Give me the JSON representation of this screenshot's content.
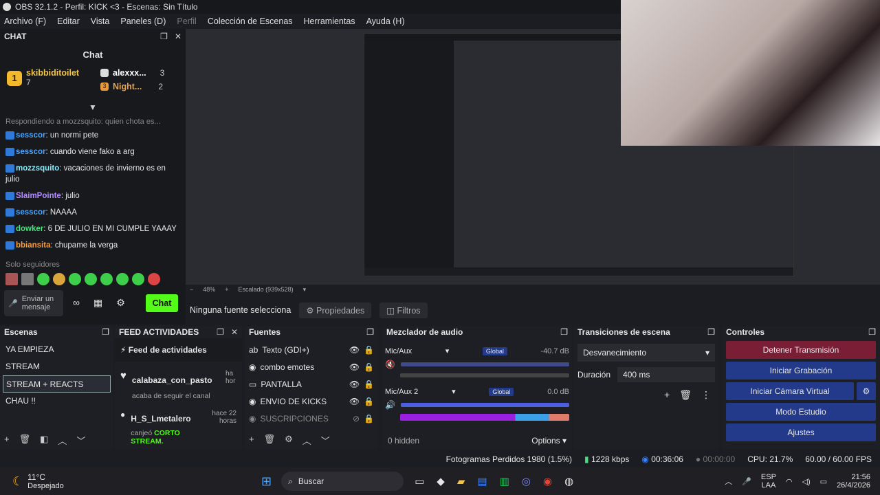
{
  "window": {
    "title": "OBS 32.1.2 - Perfil: KICK <3 - Escenas: Sin Título"
  },
  "menu": [
    "Archivo (F)",
    "Editar",
    "Vista",
    "Paneles (D)",
    "Perfil",
    "Colección de Escenas",
    "Herramientas",
    "Ayuda (H)"
  ],
  "chat": {
    "dock_title": "CHAT",
    "title": "Chat",
    "leaders": [
      {
        "rank": "1",
        "name": "skibbiditoilet",
        "count": "7"
      },
      {
        "rank": "",
        "name": "alexxx...",
        "count": "3"
      },
      {
        "rank": "3",
        "name": "Night...",
        "count": "2"
      }
    ],
    "reply": "Respondiendo a mozzsquito: quien chota es...",
    "messages": [
      {
        "user": "sesscor",
        "color": "#4fa3f7",
        "text": "un normi pete"
      },
      {
        "user": "sesscor",
        "color": "#4fa3f7",
        "text": "cuando viene fako a arg"
      },
      {
        "user": "mozzsquito",
        "color": "#8be9fd",
        "text": "vacaciones de invierno es en julio"
      },
      {
        "user": "SlaimPointe",
        "color": "#b48cff",
        "text": "julio"
      },
      {
        "user": "sesscor",
        "color": "#4fa3f7",
        "text": "NAAAA"
      },
      {
        "user": "dowker",
        "color": "#4ade80",
        "text": "6 DE JULIO EN MI CUMPLE YAAAY"
      },
      {
        "user": "bbiansita",
        "color": "#f59e42",
        "text": "chupame la verga"
      }
    ],
    "followers_label": "Solo seguidores",
    "input_placeholder": "Enviar un mensaje",
    "send_label": "Chat"
  },
  "preview": {
    "zoom": "48%",
    "scale": "Escalado (939x528)",
    "no_source": "Ninguna fuente selecciona",
    "properties": "Propiedades",
    "filters": "Filtros"
  },
  "scenes": {
    "title": "Escenas",
    "items": [
      "YA EMPIEZA",
      "STREAM",
      "STREAM + REACTS",
      "CHAU !!"
    ],
    "selected": "STREAM + REACTS"
  },
  "feed": {
    "title": "FEED ACTIVIDADES",
    "header": "Feed de actividades",
    "items": [
      {
        "user": "calabaza_con_pasto",
        "action": "acaba de seguir el canal",
        "time": "ha hor"
      },
      {
        "user": "H_S_Lmetalero",
        "action": "canjeó",
        "reward": "CORTO STREAM.",
        "time": "hace 22 horas"
      }
    ]
  },
  "sources": {
    "title": "Fuentes",
    "items": [
      "Texto (GDI+)",
      "combo emotes",
      "PANTALLA",
      "ENVIO DE KICKS",
      "SUSCRIPCIONES"
    ]
  },
  "mixer": {
    "title": "Mezclador de audio",
    "scale": [
      "-60",
      "-54",
      "-48",
      "-42",
      "-36",
      "-30",
      "-24",
      "-18",
      "-12",
      "-6",
      "0"
    ],
    "channels": [
      {
        "name": "Mic/Aux",
        "tag": "Global",
        "db": "-40.7 dB",
        "muted": true
      },
      {
        "name": "Mic/Aux 2",
        "tag": "Global",
        "db": "0.0 dB",
        "muted": false
      }
    ],
    "hidden": "0 hidden",
    "options": "Options"
  },
  "transitions": {
    "title": "Transiciones de escena",
    "selected": "Desvanecimiento",
    "duration_label": "Duración",
    "duration_value": "400 ms"
  },
  "controls": {
    "title": "Controles",
    "buttons": [
      "Detener Transmisión",
      "Iniciar Grabación",
      "Iniciar Cámara Virtual",
      "Modo Estudio",
      "Ajustes"
    ]
  },
  "status": {
    "dropped": "Fotogramas Perdidos 1980 (1.5%)",
    "bitrate": "1228 kbps",
    "stream_time": "00:36:06",
    "rec_time": "00:00:00",
    "cpu": "CPU: 21.7%",
    "fps": "60.00 / 60.00 FPS"
  },
  "taskbar": {
    "weather_temp": "11°C",
    "weather_desc": "Despejado",
    "search": "Buscar",
    "lang1": "ESP",
    "lang2": "LAA",
    "time": "21:56",
    "date": "26/4/2026"
  },
  "colors": {
    "kick_green": "#53fc18",
    "stop_red": "#7a1e35",
    "ctrl_blue": "#233a8a"
  }
}
